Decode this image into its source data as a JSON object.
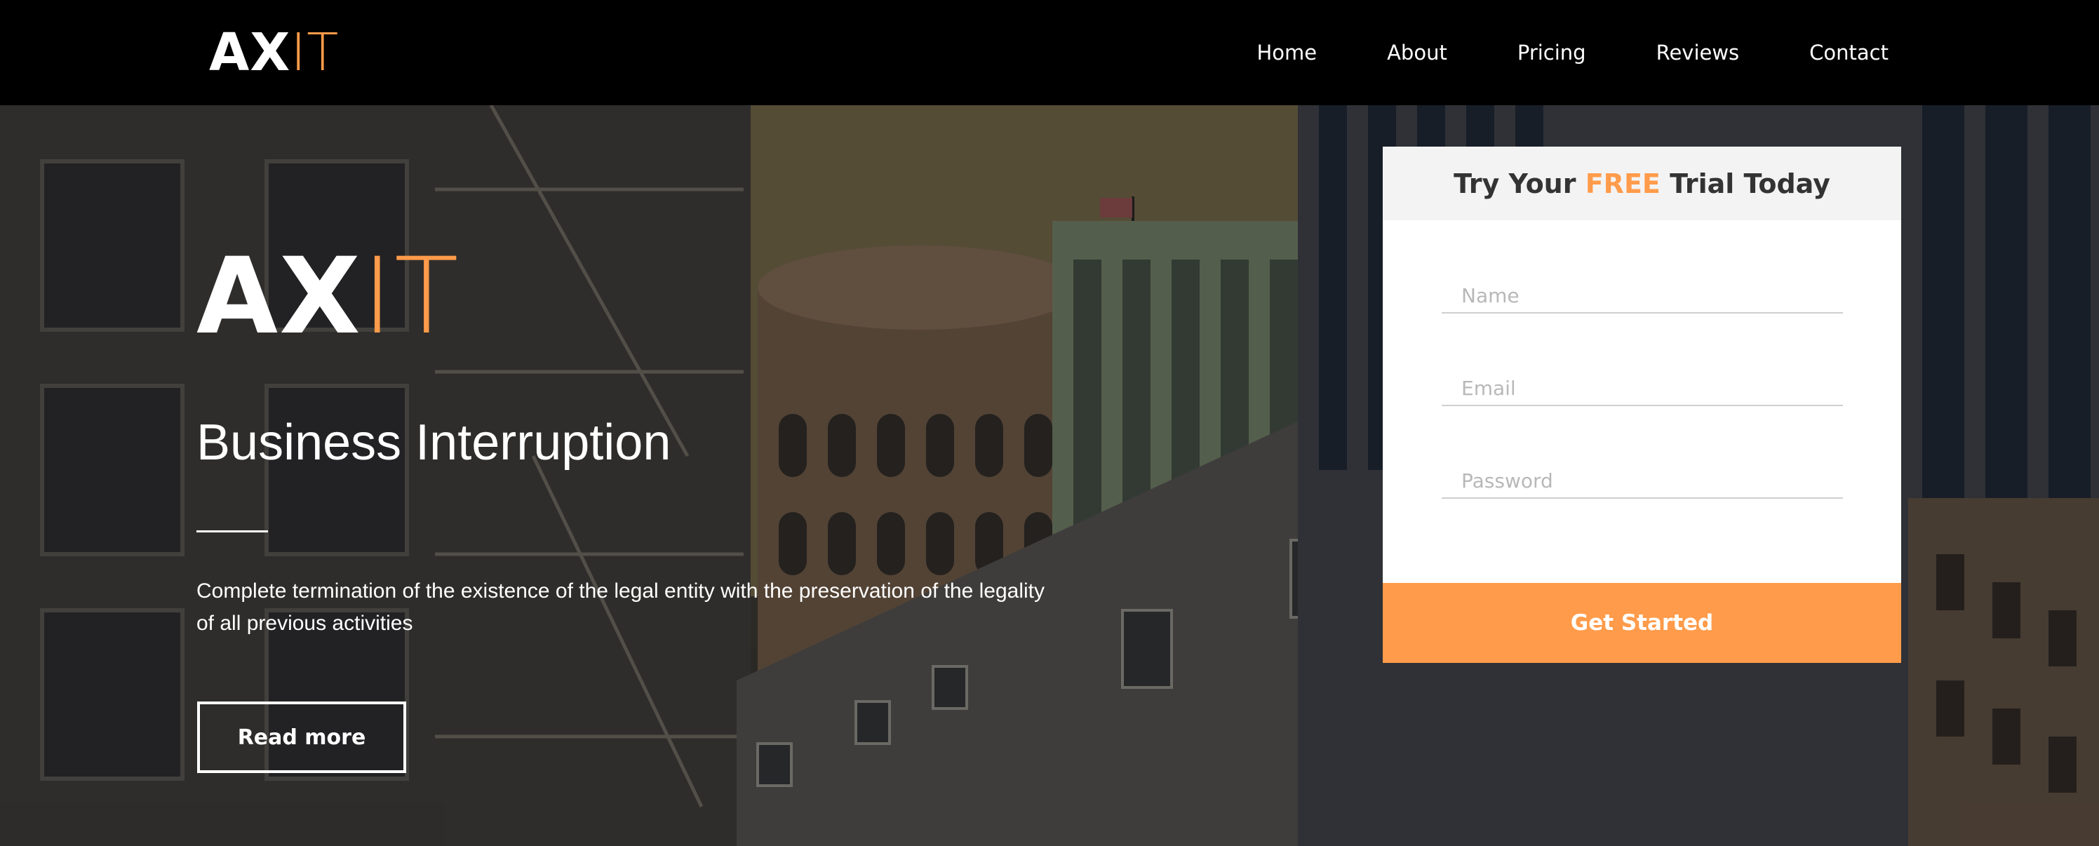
{
  "nav": {
    "logo_ax": "AX",
    "logo_it": "IT",
    "links": [
      "Home",
      "About",
      "Pricing",
      "Reviews",
      "Contact"
    ]
  },
  "hero": {
    "logo_ax": "AX",
    "logo_it": "IT",
    "title": "Business Interruption",
    "description": "Complete termination of the existence of the legal entity with the preservation of the legality of all previous activities",
    "read_more_label": "Read more"
  },
  "form": {
    "heading_pre": "Try Your ",
    "heading_free": "FREE",
    "heading_post": " Trial Today",
    "name_placeholder": "Name",
    "email_placeholder": "Email",
    "password_placeholder": "Password",
    "submit_label": "Get Started"
  },
  "colors": {
    "accent": "#ff9b4a",
    "nav_bg": "#000000",
    "form_header_bg": "#f3f3f3"
  }
}
